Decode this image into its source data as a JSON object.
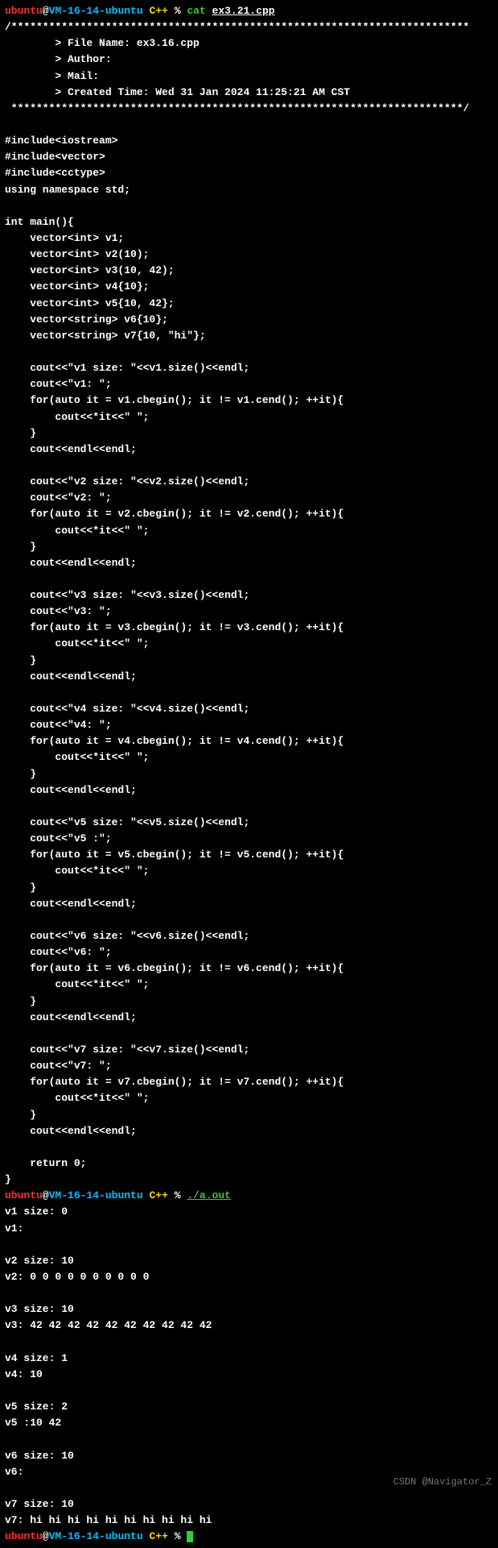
{
  "prompt": {
    "user": "ubuntu",
    "at": "@",
    "host": "VM-16-14-ubuntu",
    "dir": "C++",
    "sym": "%"
  },
  "cmd1": {
    "cat": "cat",
    "file": "ex3.21.cpp"
  },
  "source_lines": [
    "/*************************************************************************",
    "        > File Name: ex3.16.cpp",
    "        > Author:",
    "        > Mail:",
    "        > Created Time: Wed 31 Jan 2024 11:25:21 AM CST",
    " ************************************************************************/",
    "",
    "#include<iostream>",
    "#include<vector>",
    "#include<cctype>",
    "using namespace std;",
    "",
    "int main(){",
    "    vector<int> v1;",
    "    vector<int> v2(10);",
    "    vector<int> v3(10, 42);",
    "    vector<int> v4{10};",
    "    vector<int> v5{10, 42};",
    "    vector<string> v6{10};",
    "    vector<string> v7{10, \"hi\"};",
    "",
    "    cout<<\"v1 size: \"<<v1.size()<<endl;",
    "    cout<<\"v1: \";",
    "    for(auto it = v1.cbegin(); it != v1.cend(); ++it){",
    "        cout<<*it<<\" \";",
    "    }",
    "    cout<<endl<<endl;",
    "",
    "    cout<<\"v2 size: \"<<v2.size()<<endl;",
    "    cout<<\"v2: \";",
    "    for(auto it = v2.cbegin(); it != v2.cend(); ++it){",
    "        cout<<*it<<\" \";",
    "    }",
    "    cout<<endl<<endl;",
    "",
    "    cout<<\"v3 size: \"<<v3.size()<<endl;",
    "    cout<<\"v3: \";",
    "    for(auto it = v3.cbegin(); it != v3.cend(); ++it){",
    "        cout<<*it<<\" \";",
    "    }",
    "    cout<<endl<<endl;",
    "",
    "    cout<<\"v4 size: \"<<v4.size()<<endl;",
    "    cout<<\"v4: \";",
    "    for(auto it = v4.cbegin(); it != v4.cend(); ++it){",
    "        cout<<*it<<\" \";",
    "    }",
    "    cout<<endl<<endl;",
    "",
    "    cout<<\"v5 size: \"<<v5.size()<<endl;",
    "    cout<<\"v5 :\";",
    "    for(auto it = v5.cbegin(); it != v5.cend(); ++it){",
    "        cout<<*it<<\" \";",
    "    }",
    "    cout<<endl<<endl;",
    "",
    "    cout<<\"v6 size: \"<<v6.size()<<endl;",
    "    cout<<\"v6: \";",
    "    for(auto it = v6.cbegin(); it != v6.cend(); ++it){",
    "        cout<<*it<<\" \";",
    "    }",
    "    cout<<endl<<endl;",
    "",
    "    cout<<\"v7 size: \"<<v7.size()<<endl;",
    "    cout<<\"v7: \";",
    "    for(auto it = v7.cbegin(); it != v7.cend(); ++it){",
    "        cout<<*it<<\" \";",
    "    }",
    "    cout<<endl<<endl;",
    "",
    "    return 0;",
    "}"
  ],
  "cmd2": {
    "run": "./a.out"
  },
  "output_lines": [
    "v1 size: 0",
    "v1:",
    "",
    "v2 size: 10",
    "v2: 0 0 0 0 0 0 0 0 0 0",
    "",
    "v3 size: 10",
    "v3: 42 42 42 42 42 42 42 42 42 42",
    "",
    "v4 size: 1",
    "v4: 10",
    "",
    "v5 size: 2",
    "v5 :10 42",
    "",
    "v6 size: 10",
    "v6:",
    "",
    "v7 size: 10",
    "v7: hi hi hi hi hi hi hi hi hi hi",
    ""
  ],
  "watermark": "CSDN @Navigator_Z"
}
